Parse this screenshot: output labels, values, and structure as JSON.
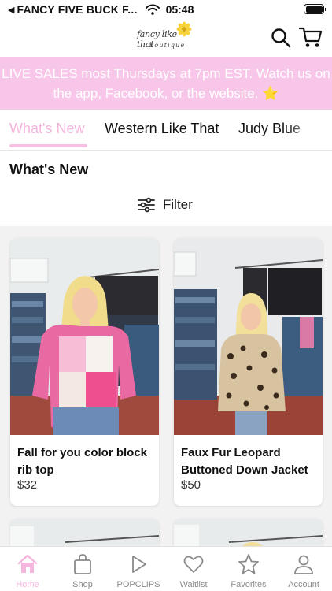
{
  "status_bar": {
    "back_glyph": "◀",
    "carrier": "FANCY FIVE BUCK F...",
    "time": "05:48",
    "icons": [
      "wifi-icon",
      "battery-icon"
    ]
  },
  "header": {
    "logo_line1": "fancy like that",
    "logo_line2": "boutique",
    "icons": [
      "search-icon",
      "cart-icon"
    ]
  },
  "banner": {
    "text": "LIVE SALES most Thursdays at 7pm EST. Watch us on the app, Facebook, or the website.",
    "emoji": "⭐"
  },
  "tabs": [
    {
      "label": "What's New",
      "active": true
    },
    {
      "label": "Western Like That",
      "active": false
    },
    {
      "label": "Judy Blue",
      "active": false
    }
  ],
  "section_title": "What's New",
  "filter": {
    "label": "Filter",
    "icon": "sliders-icon"
  },
  "products": [
    {
      "name": "Fall for you color block rib top",
      "price": "$32"
    },
    {
      "name": "Faux Fur Leopard Buttoned Down Jacket",
      "price": "$50"
    }
  ],
  "bottom_nav": [
    {
      "label": "Home",
      "icon": "home-icon",
      "active": true
    },
    {
      "label": "Shop",
      "icon": "shopping-bag-icon",
      "active": false
    },
    {
      "label": "POPCLIPS",
      "icon": "play-icon",
      "active": false
    },
    {
      "label": "Waitlist",
      "icon": "heart-icon",
      "active": false
    },
    {
      "label": "Favorites",
      "icon": "star-icon",
      "active": false
    },
    {
      "label": "Account",
      "icon": "person-icon",
      "active": false
    }
  ],
  "colors": {
    "accent_pink": "#f4b6dd",
    "banner_bg": "#f8c6e8",
    "text": "#111111",
    "muted": "#8a8a8a"
  }
}
